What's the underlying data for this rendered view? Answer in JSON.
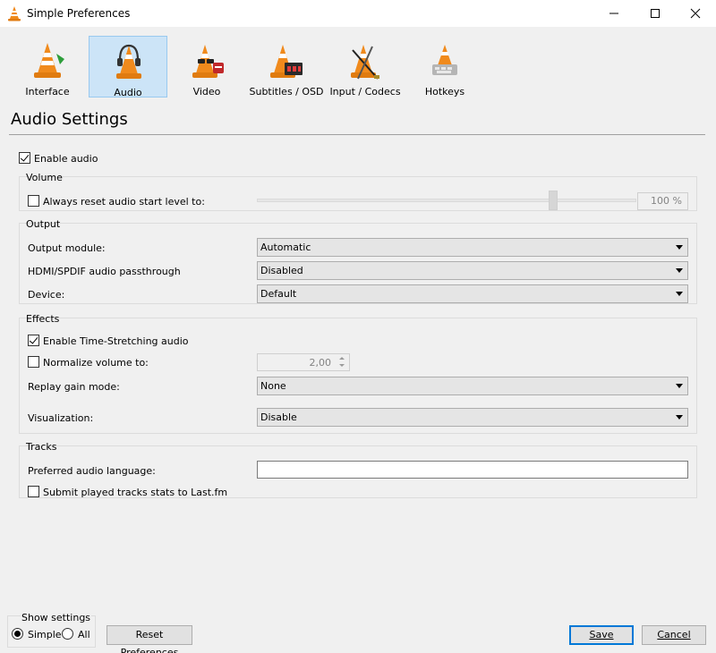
{
  "window": {
    "title": "Simple Preferences"
  },
  "categories": [
    {
      "label": "Interface",
      "icon": "vlc-cone-icon"
    },
    {
      "label": "Audio",
      "icon": "headphones-cone-icon",
      "selected": true
    },
    {
      "label": "Video",
      "icon": "glasses-cone-icon"
    },
    {
      "label": "Subtitles / OSD",
      "icon": "subtitles-cone-icon"
    },
    {
      "label": "Input / Codecs",
      "icon": "cables-cone-icon"
    },
    {
      "label": "Hotkeys",
      "icon": "hotkeys-cone-icon"
    }
  ],
  "heading": "Audio Settings",
  "enable_audio": {
    "label": "Enable audio",
    "checked": true
  },
  "volume": {
    "title": "Volume",
    "reset_label": "Always reset audio start level to:",
    "reset_checked": false,
    "level_value": "100 %",
    "slider_fraction": 0.78
  },
  "output": {
    "title": "Output",
    "module_label": "Output module:",
    "module_value": "Automatic",
    "passthrough_label": "HDMI/SPDIF audio passthrough",
    "passthrough_value": "Disabled",
    "device_label": "Device:",
    "device_value": "Default"
  },
  "effects": {
    "title": "Effects",
    "timestretch_label": "Enable Time-Stretching audio",
    "timestretch_checked": true,
    "normalize_label": "Normalize volume to:",
    "normalize_checked": false,
    "normalize_value": "2,00",
    "replaygain_label": "Replay gain mode:",
    "replaygain_value": "None",
    "visualization_label": "Visualization:",
    "visualization_value": "Disable"
  },
  "tracks": {
    "title": "Tracks",
    "language_label": "Preferred audio language:",
    "language_value": "",
    "lastfm_label": "Submit played tracks stats to Last.fm",
    "lastfm_checked": false
  },
  "footer": {
    "show_settings_title": "Show settings",
    "simple_label": "Simple",
    "all_label": "All",
    "selected_mode": "Simple",
    "reset_button": "Reset Preferences",
    "save_button": "Save",
    "cancel_button": "Cancel"
  },
  "colors": {
    "selected_bg": "#cce4f7",
    "selected_border": "#99c9ef",
    "vlc_orange": "#f08a1c"
  }
}
